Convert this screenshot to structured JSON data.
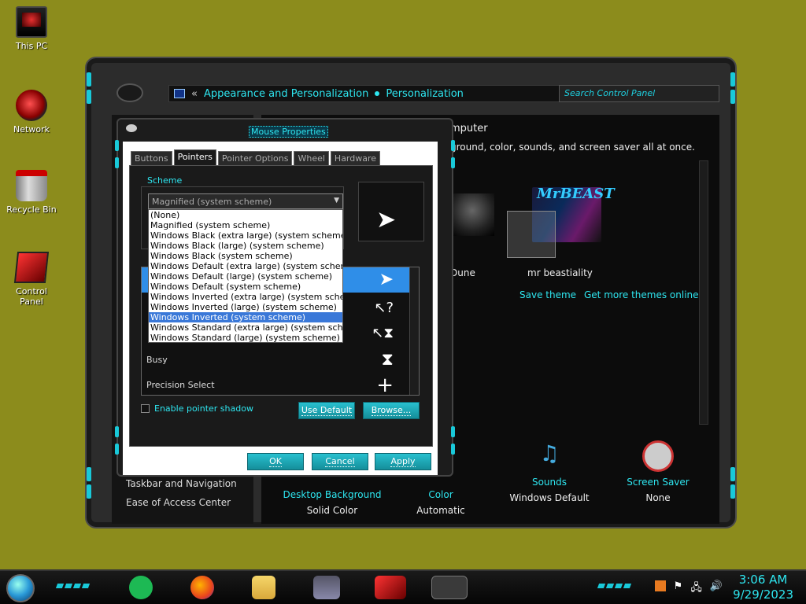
{
  "desktop": {
    "icons": [
      {
        "label": "This PC"
      },
      {
        "label": "Network"
      },
      {
        "label": "Recycle Bin"
      },
      {
        "label": "Control Panel"
      }
    ]
  },
  "control_panel": {
    "breadcrumb": [
      "Appearance and Personalization",
      "Personalization"
    ],
    "breadcrumb_back": "«",
    "search_placeholder": "Search Control Panel",
    "main_title": "mputer",
    "main_description": "ground, color, sounds, and screen saver all at once.",
    "themes": [
      {
        "label": "Dune"
      },
      {
        "label": "mr beastiality",
        "brand": "MrBEAST"
      }
    ],
    "links": {
      "save_theme": "Save theme",
      "get_more": "Get more themes online"
    },
    "left_links": [
      "Taskbar and Navigation",
      "Ease of Access Center"
    ],
    "bottom_items": [
      {
        "title": "Desktop Background",
        "value": "Solid Color"
      },
      {
        "title": "Color",
        "value": "Automatic"
      },
      {
        "title": "Sounds",
        "value": "Windows Default"
      },
      {
        "title": "Screen Saver",
        "value": "None"
      }
    ]
  },
  "mouse_dialog": {
    "title": "Mouse Properties",
    "tabs": [
      "Buttons",
      "Pointers",
      "Pointer Options",
      "Wheel",
      "Hardware"
    ],
    "active_tab": "Pointers",
    "scheme_label": "Scheme",
    "scheme_selected": "Magnified (system scheme)",
    "scheme_options": [
      "(None)",
      "Magnified (system scheme)",
      "Windows Black (extra large) (system scheme)",
      "Windows Black (large) (system scheme)",
      "Windows Black (system scheme)",
      "Windows Default (extra large) (system scheme)",
      "Windows Default (large) (system scheme)",
      "Windows Default (system scheme)",
      "Windows Inverted (extra large) (system scheme)",
      "Windows Inverted (large) (system scheme)",
      "Windows Inverted (system scheme)",
      "Windows Standard (extra large) (system scheme)",
      "Windows Standard (large) (system scheme)"
    ],
    "highlighted_option": "Windows Inverted (system scheme)",
    "cursor_rows": [
      {
        "label": "",
        "glyph": "➤"
      },
      {
        "label": "",
        "glyph": "↖?"
      },
      {
        "label": "",
        "glyph": "↖⧗"
      },
      {
        "label": "Busy",
        "glyph": "⧗"
      },
      {
        "label": "Precision Select",
        "glyph": "+"
      }
    ],
    "shadow_label": "Enable pointer shadow",
    "buttons": {
      "use_default": "Use Default",
      "browse": "Browse...",
      "ok": "OK",
      "cancel": "Cancel",
      "apply": "Apply"
    }
  },
  "taskbar": {
    "time": "3:06 AM",
    "date": "9/29/2023",
    "tray_glyphs": [
      "⚑",
      "🖧",
      "🔊"
    ]
  }
}
